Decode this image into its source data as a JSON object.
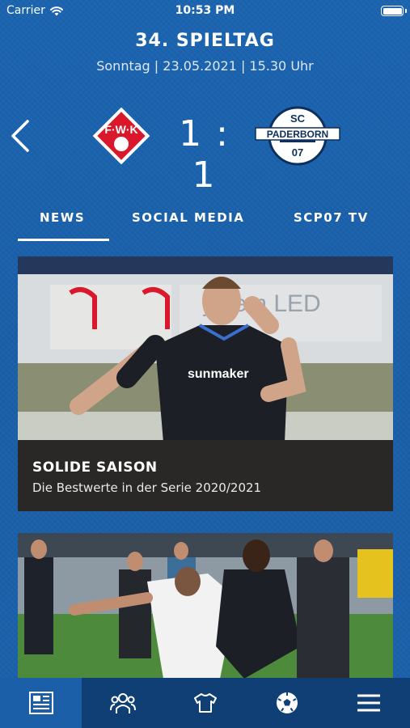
{
  "status_bar": {
    "carrier": "Carrier",
    "time": "10:53 PM"
  },
  "match": {
    "matchday": "34. SPIELTAG",
    "date": "Sonntag | 23.05.2021 | 15.30 Uhr",
    "score": "1 : 1",
    "home_crest_text": "F·W·K",
    "away_crest_text": {
      "top": "SC",
      "middle": "PADERBORN",
      "bottom": "07"
    }
  },
  "tabs": [
    {
      "label": "NEWS",
      "active": true
    },
    {
      "label": "SOCIAL MEDIA",
      "active": false
    },
    {
      "label": "SCP07 TV",
      "active": false
    }
  ],
  "news": [
    {
      "title": "SOLIDE SAISON",
      "subtitle": "Die Bestwerte in der Serie 2020/2021"
    }
  ],
  "photo_text": {
    "sponsor": "sunmaker",
    "banner": "ystem LED"
  },
  "bottom_nav": [
    {
      "icon": "news-icon",
      "active": true
    },
    {
      "icon": "team-icon",
      "active": false
    },
    {
      "icon": "jersey-icon",
      "active": false
    },
    {
      "icon": "soccer-ball-icon",
      "active": false
    },
    {
      "icon": "menu-icon",
      "active": false
    }
  ],
  "colors": {
    "background": "#1a5fa8",
    "home_red": "#d9182b",
    "caption_bg": "#2a2826",
    "nav_bg": "#0f3f74"
  }
}
